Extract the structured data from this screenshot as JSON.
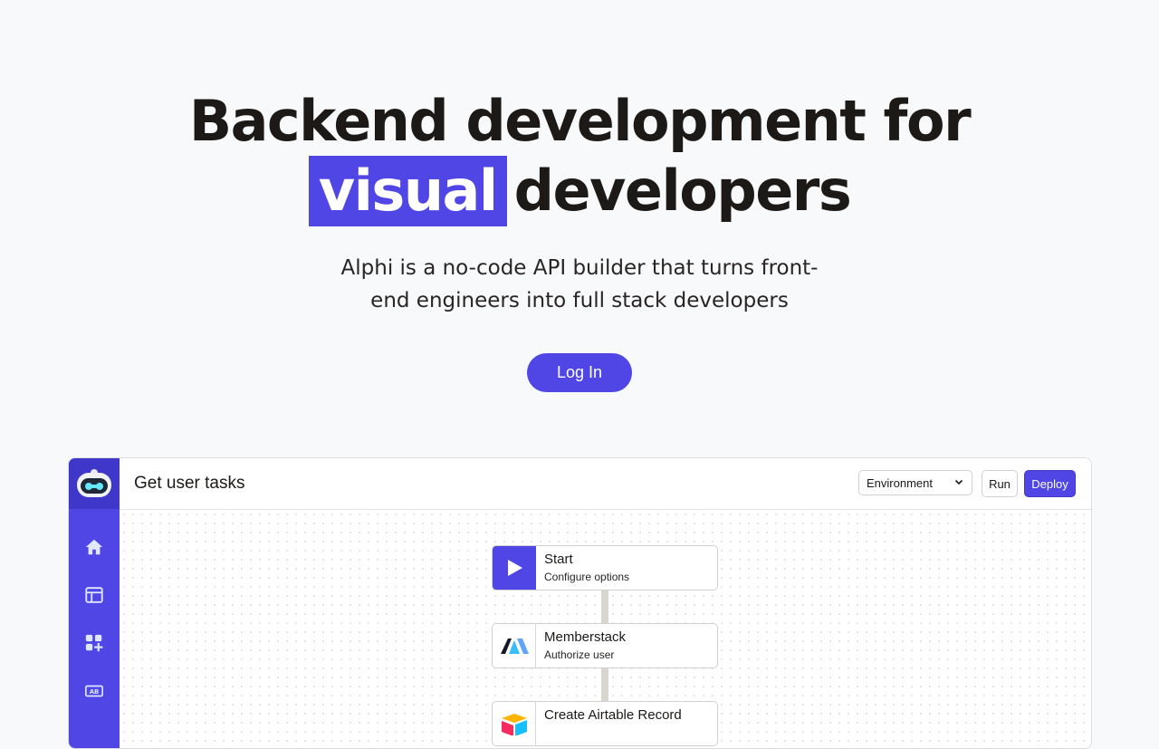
{
  "hero": {
    "headline_line1": "Backend development for",
    "headline_highlight": "visual",
    "headline_line2_rest": "developers",
    "subtitle": "Alphi is a no-code API builder that turns front-end engineers into full stack developers",
    "login_label": "Log In"
  },
  "colors": {
    "accent": "#4f46e5",
    "background": "#f8f9fb",
    "text": "#1c1917"
  },
  "app": {
    "title": "Get user tasks",
    "environment_label": "Environment",
    "run_label": "Run",
    "deploy_label": "Deploy",
    "sidebar_icons": [
      "robot-logo-icon",
      "home-icon",
      "layout-icon",
      "add-widget-icon",
      "text-field-icon"
    ],
    "nodes": [
      {
        "title": "Start",
        "subtitle": "Configure options",
        "icon": "play-icon"
      },
      {
        "title": "Memberstack",
        "subtitle": "Authorize user",
        "icon": "memberstack-logo-icon"
      },
      {
        "title": "Create Airtable Record",
        "subtitle": "",
        "icon": "airtable-logo-icon"
      }
    ]
  }
}
